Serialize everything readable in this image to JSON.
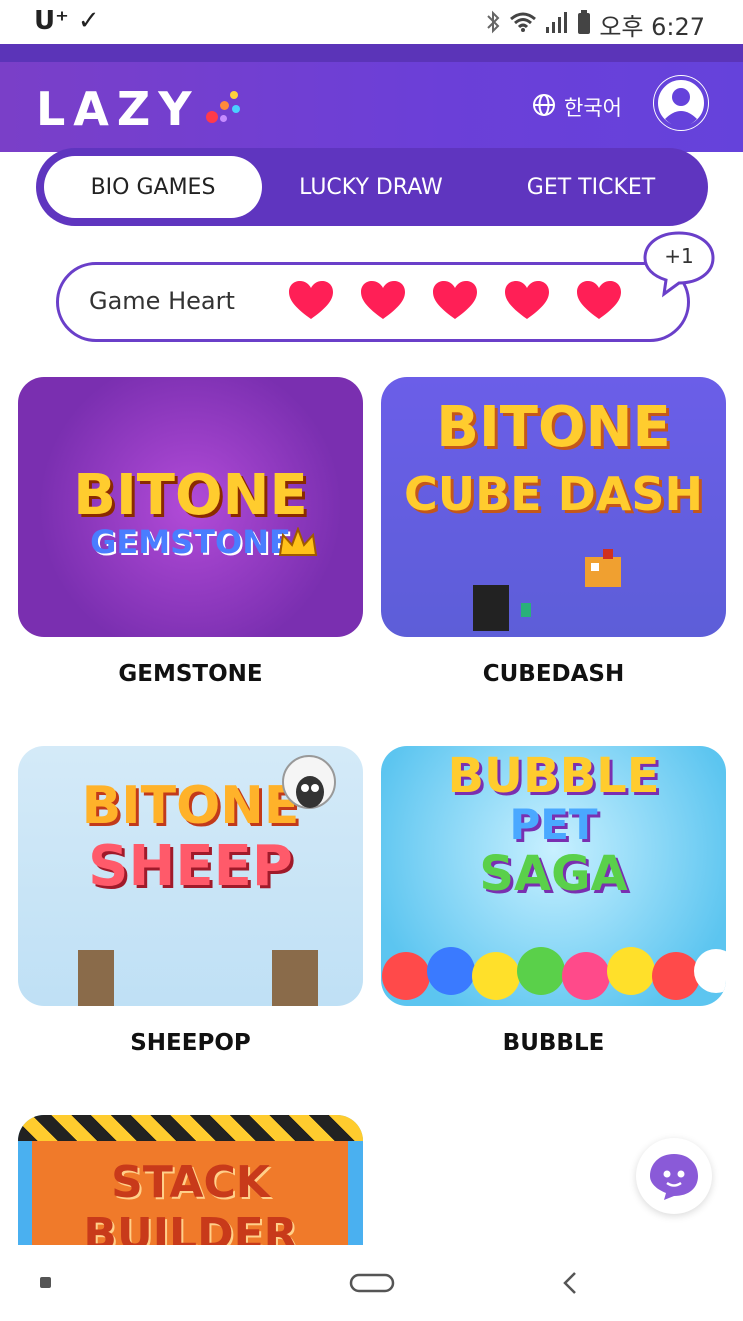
{
  "status_bar": {
    "carrier": "U⁺ ✓",
    "time": "오후 6:27"
  },
  "header": {
    "logo": "LAZY",
    "language": "한국어"
  },
  "tabs": [
    {
      "label": "BIO GAMES",
      "active": true
    },
    {
      "label": "LUCKY DRAW",
      "active": false
    },
    {
      "label": "GET TICKET",
      "active": false
    }
  ],
  "hearts": {
    "label": "Game Heart",
    "count": 5,
    "bonus": "+1",
    "color": "#ff1f56"
  },
  "games": [
    {
      "title": "GEMSTONE",
      "thumb_line1": "BITONE",
      "thumb_line2": "GEMSTONE"
    },
    {
      "title": "CUBEDASH",
      "thumb_line1": "BITONE",
      "thumb_line2": "CUBE DASH"
    },
    {
      "title": "SHEEPOP",
      "thumb_line1": "BITONE",
      "thumb_line2": "SHEEP"
    },
    {
      "title": "BUBBLE",
      "thumb_line1": "BUBBLE",
      "thumb_line2": "PET",
      "thumb_line3": "SAGA"
    },
    {
      "title": "",
      "thumb_line1": "STACK",
      "thumb_line2": "BUILDER"
    }
  ],
  "colors": {
    "accent": "#6a3fc9",
    "header_start": "#7a3fc8",
    "header_end": "#6542db"
  }
}
